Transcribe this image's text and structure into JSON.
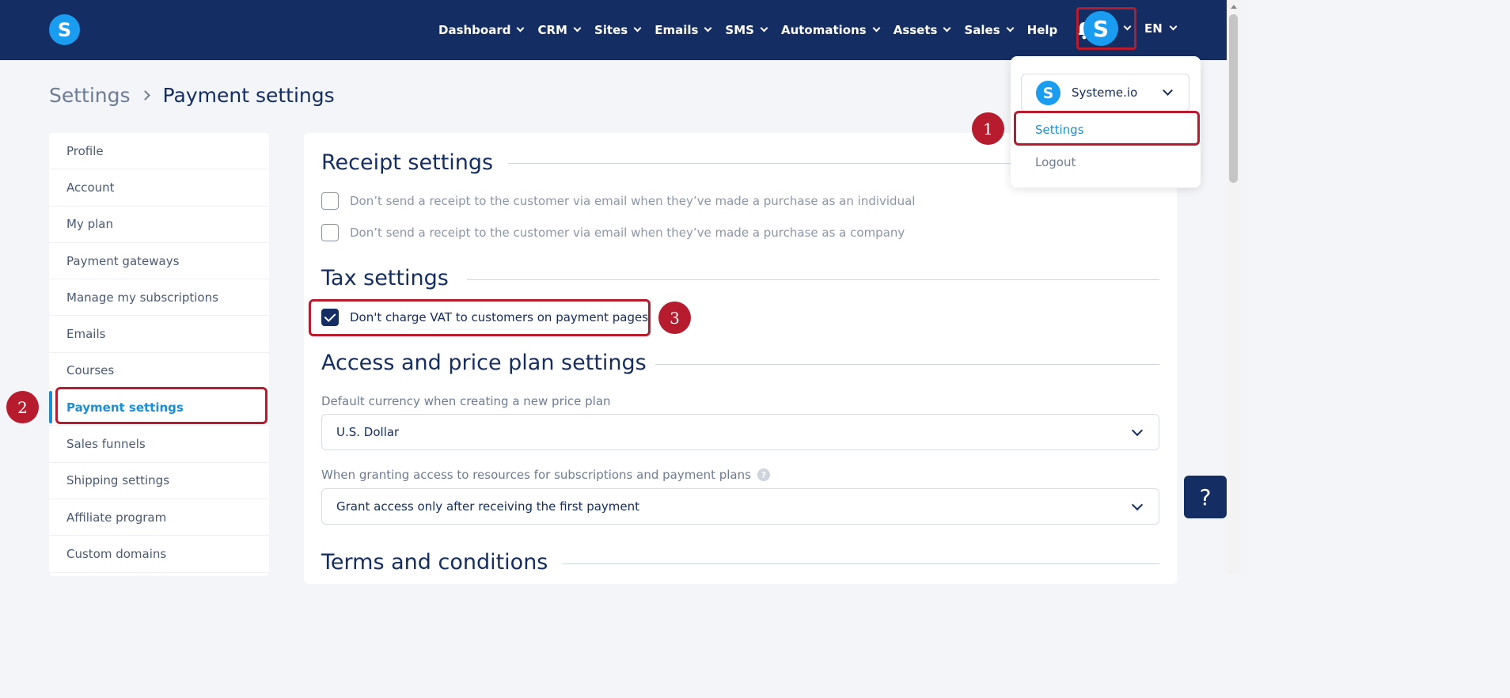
{
  "brand": {
    "logo_letter": "S",
    "accent": "#1a9cf0",
    "nav_bg": "#142d63",
    "highlight": "#b71c2e"
  },
  "topnav": {
    "items": [
      {
        "label": "Dashboard",
        "has_dropdown": true
      },
      {
        "label": "CRM",
        "has_dropdown": true
      },
      {
        "label": "Sites",
        "has_dropdown": true
      },
      {
        "label": "Emails",
        "has_dropdown": true
      },
      {
        "label": "SMS",
        "has_dropdown": true
      },
      {
        "label": "Automations",
        "has_dropdown": true
      },
      {
        "label": "Assets",
        "has_dropdown": true
      },
      {
        "label": "Sales",
        "has_dropdown": true
      },
      {
        "label": "Help",
        "has_dropdown": false
      }
    ],
    "notification_icon": "bell-icon",
    "avatar_letter": "S",
    "language": "EN"
  },
  "breadcrumb": {
    "parent": "Settings",
    "current": "Payment settings"
  },
  "sidebar": {
    "items": [
      {
        "label": "Profile",
        "active": false
      },
      {
        "label": "Account",
        "active": false
      },
      {
        "label": "My plan",
        "active": false
      },
      {
        "label": "Payment gateways",
        "active": false
      },
      {
        "label": "Manage my subscriptions",
        "active": false
      },
      {
        "label": "Emails",
        "active": false
      },
      {
        "label": "Courses",
        "active": false
      },
      {
        "label": "Payment settings",
        "active": true
      },
      {
        "label": "Sales funnels",
        "active": false
      },
      {
        "label": "Shipping settings",
        "active": false
      },
      {
        "label": "Affiliate program",
        "active": false
      },
      {
        "label": "Custom domains",
        "active": false
      }
    ]
  },
  "receipt": {
    "title": "Receipt settings",
    "options": [
      {
        "label": "Don’t send a receipt to the customer via email when they’ve made a purchase as an individual",
        "checked": false
      },
      {
        "label": "Don’t send a receipt to the customer via email when they’ve made a purchase as a company",
        "checked": false
      }
    ]
  },
  "tax": {
    "title": "Tax settings",
    "option": {
      "label": "Don't charge VAT to customers on payment pages",
      "checked": true
    }
  },
  "access": {
    "title": "Access and price plan settings",
    "currency_label": "Default currency when creating a new price plan",
    "currency_value": "U.S. Dollar",
    "grant_label": "When granting access to resources for subscriptions and payment plans",
    "grant_help": "?",
    "grant_value": "Grant access only after receiving the first payment"
  },
  "terms": {
    "title": "Terms and conditions"
  },
  "account_menu": {
    "workspace_letter": "S",
    "workspace_name": "Systeme.io",
    "items": [
      {
        "label": "Settings",
        "active": true
      },
      {
        "label": "Logout",
        "active": false
      }
    ]
  },
  "annotations": {
    "step1": "1",
    "step2": "2",
    "step3": "3"
  },
  "help_button": "?"
}
